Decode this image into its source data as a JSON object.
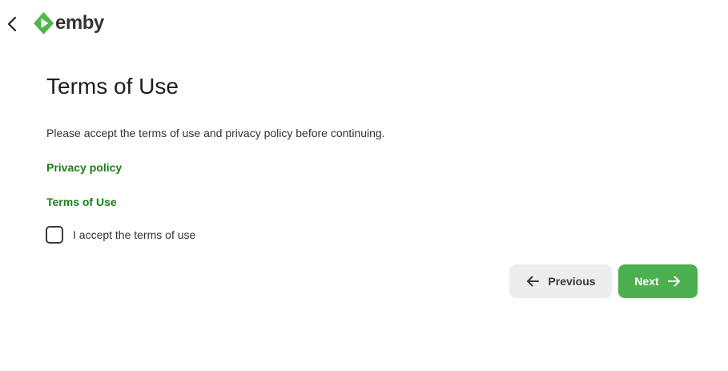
{
  "header": {
    "back_icon": "chevron-left-icon",
    "logo_icon": "emby-logo-icon",
    "logo_text": "emby",
    "brand_color": "#52b54b"
  },
  "main": {
    "title": "Terms of Use",
    "description": "Please accept the terms of use and privacy policy before continuing.",
    "privacy_link": "Privacy policy",
    "terms_link": "Terms of Use",
    "link_color": "#198019",
    "accept_checkbox": {
      "label": "I accept the terms of use",
      "checked": false
    }
  },
  "footer": {
    "previous": {
      "label": "Previous",
      "icon": "arrow-left-icon"
    },
    "next": {
      "label": "Next",
      "icon": "arrow-right-icon",
      "color": "#4caf50"
    }
  }
}
